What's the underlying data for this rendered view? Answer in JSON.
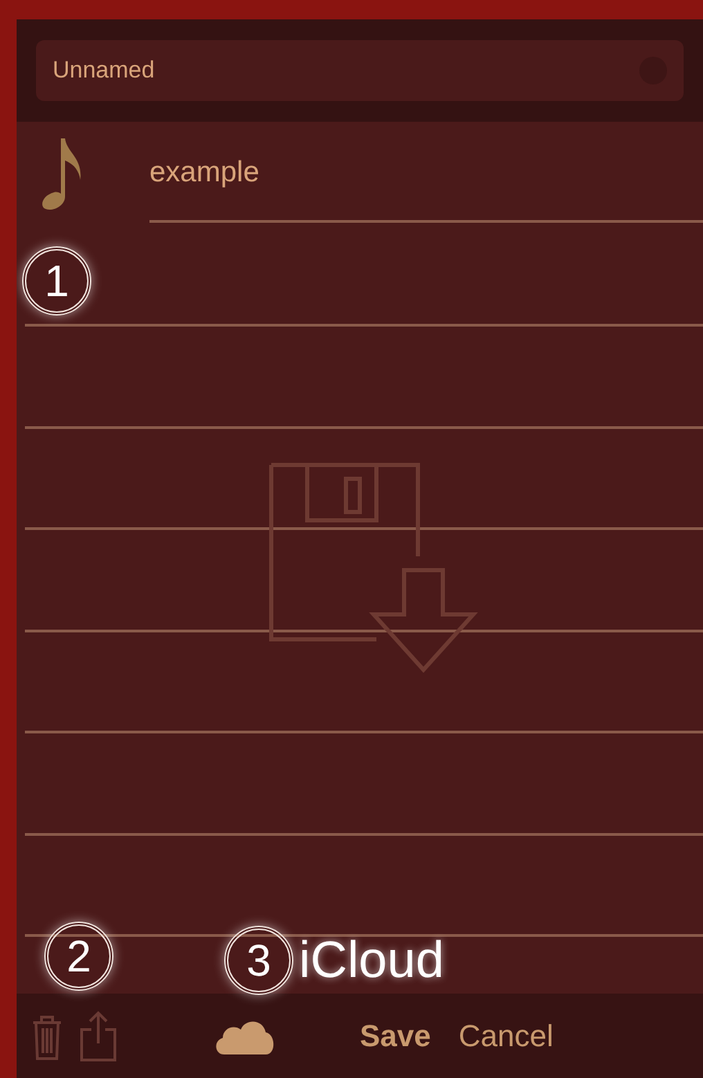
{
  "name_field": {
    "value": "Unnamed"
  },
  "files": [
    {
      "name": "example"
    }
  ],
  "callouts": [
    {
      "number": "1"
    },
    {
      "number": "2"
    },
    {
      "number": "3",
      "label": "iCloud"
    }
  ],
  "toolbar": [
    {
      "kind": "trash",
      "disabled": true
    },
    {
      "kind": "share",
      "disabled": true
    },
    {
      "kind": "cloud",
      "disabled": false
    },
    {
      "kind": "text",
      "label": "Save",
      "bold": true,
      "disabled": false
    },
    {
      "kind": "text",
      "label": "Cancel",
      "bold": false,
      "disabled": false
    }
  ]
}
